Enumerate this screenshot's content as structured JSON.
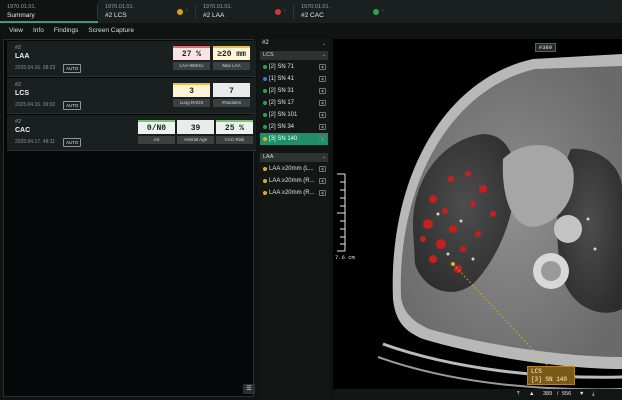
{
  "tabs": [
    {
      "date": "1970.01.01.",
      "name": "Summary",
      "active": true
    },
    {
      "date": "1970.01.01.",
      "name": "#2 LCS",
      "dot": "#d9a21a"
    },
    {
      "date": "1970.01.01.",
      "name": "#2 LAA",
      "dot": "#cf3b3b"
    },
    {
      "date": "1970.01.01.",
      "name": "#2 CAC",
      "dot": "#2ea34f"
    }
  ],
  "menu": [
    "View",
    "Info",
    "Findings",
    "Screen Capture"
  ],
  "rows": [
    {
      "num": "#2",
      "title": "LAA",
      "datetime": "2025.04.16. 08:23",
      "auto": "AUTO",
      "metrics": [
        {
          "value": "27 %",
          "label": "LAA-950HU",
          "accent": "#e26b6b",
          "bg": "#fbe3e3"
        },
        {
          "value": "≥20 mm",
          "label": "Max LAA",
          "accent": "#e4c257",
          "bg": "#fff4d6"
        }
      ]
    },
    {
      "num": "#2",
      "title": "LCS",
      "datetime": "2025.04.16. 09:02",
      "auto": "AUTO",
      "metrics": [
        {
          "value": "3",
          "label": "Lung RADS",
          "accent": "#e4c257",
          "bg": "#fff4d6"
        },
        {
          "value": "7",
          "label": "#Nodules",
          "accent": "#e9ecea",
          "bg": "#e9ecea"
        }
      ]
    },
    {
      "num": "#2",
      "title": "CAC",
      "datetime": "2025.04.17. 48:11",
      "auto": "AUTO",
      "metrics": [
        {
          "value": "0/N0",
          "label": "AS",
          "accent": "#7bc37b",
          "bg": "#eef2ee"
        },
        {
          "value": "39",
          "label": "Arterial Age",
          "accent": "#e9ecea",
          "bg": "#e9ecea"
        },
        {
          "value": "25 %",
          "label": "CAC-Risk",
          "accent": "#7bc37b",
          "bg": "#eef2ee"
        }
      ]
    }
  ],
  "series_panel": {
    "header": "#2",
    "lcs_group": "LCS",
    "lcs_items": [
      {
        "label": "[2] SN 71",
        "dot": "#2ea34f"
      },
      {
        "label": "[1] SN 41",
        "dot": "#3a7bd5"
      },
      {
        "label": "[2] SN 31",
        "dot": "#2ea34f"
      },
      {
        "label": "[2] SN 17",
        "dot": "#2ea34f"
      },
      {
        "label": "[2] SN 101",
        "dot": "#2ea34f"
      },
      {
        "label": "[2] SN 34",
        "dot": "#2ea34f"
      },
      {
        "label": "[3] SN 140",
        "dot": "#e0b020",
        "selected": true
      }
    ],
    "laa_group": "LAA",
    "laa_items": [
      {
        "label": "LAA ≥20mm (L...",
        "dot": "#e0b020"
      },
      {
        "label": "LAA ≥20mm (R...",
        "dot": "#e0b020"
      },
      {
        "label": "LAA ≥20mm (R...",
        "dot": "#e0b020"
      }
    ]
  },
  "viewer": {
    "slice_badge": "#389",
    "scale_label": "7.6 cm",
    "callout_title": "LCS",
    "callout_text": "[3] SN 140"
  },
  "footer": {
    "slice": "389",
    "total": "556"
  }
}
